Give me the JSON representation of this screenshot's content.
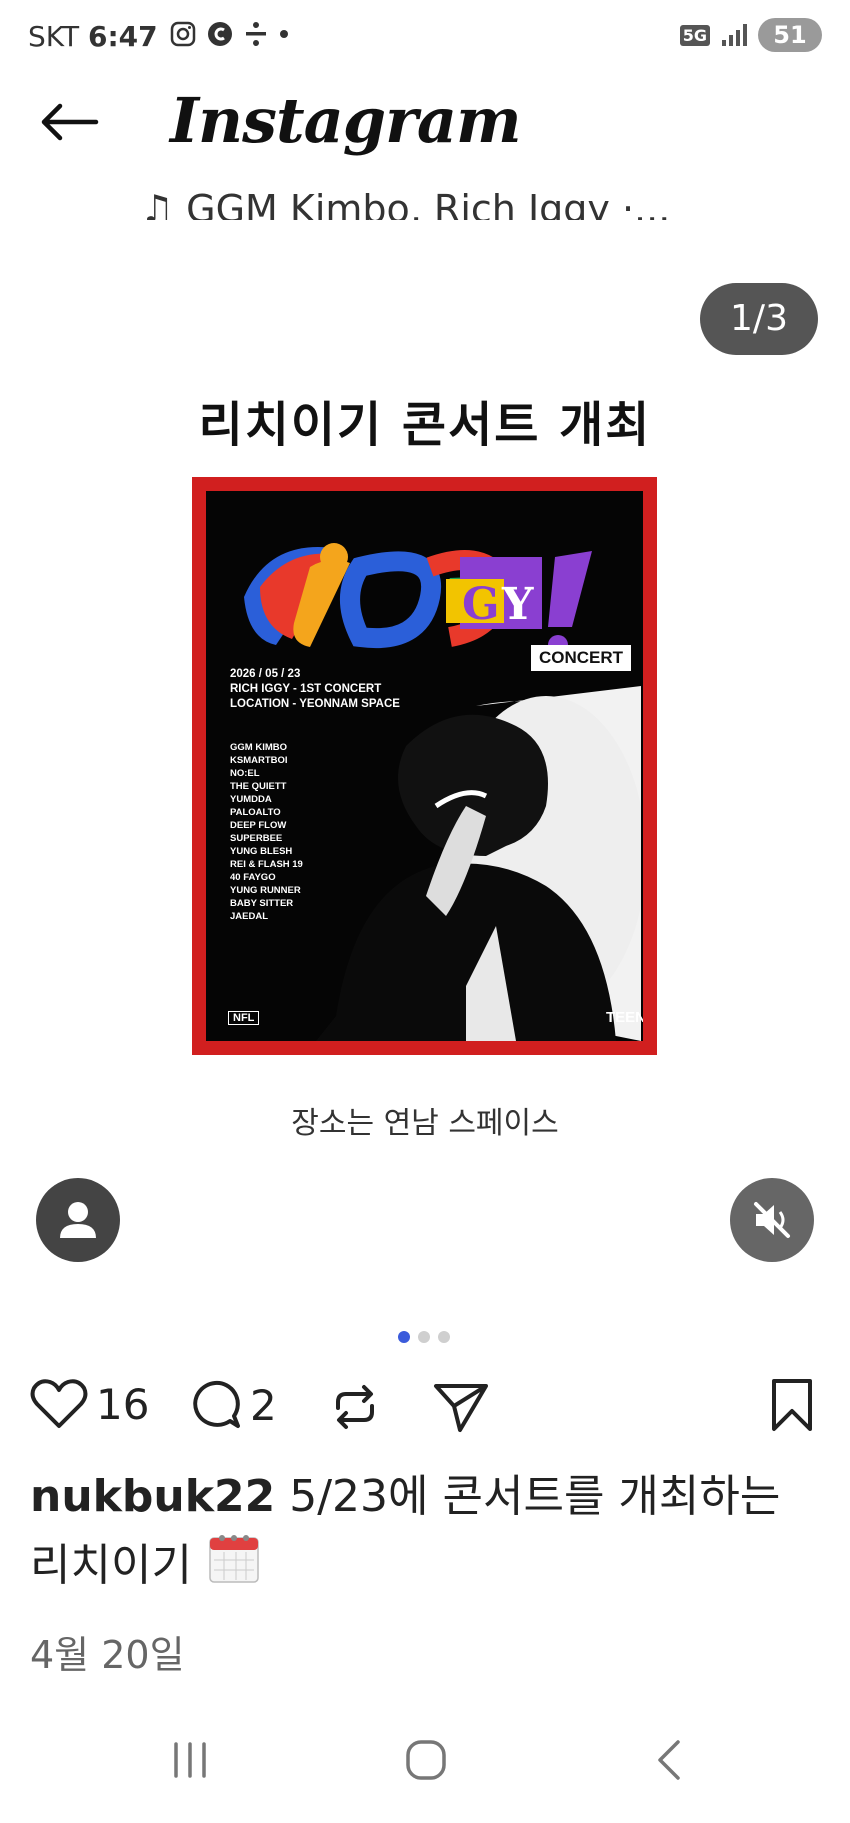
{
  "status_bar": {
    "carrier": "SKT",
    "time": "6:47",
    "network": "5G",
    "battery": "51"
  },
  "header": {
    "brand": "Instagram"
  },
  "music": {
    "ticker": "GGM Kimbo, Rich Iggy ·..."
  },
  "post": {
    "counter": "1/3",
    "title": "리치이기 콘서트 개최",
    "slide_caption": "장소는 연남 스페이스",
    "poster": {
      "logo_text": "iGGY!",
      "concert_badge": "CONCERT",
      "info": [
        "2026 / 05 / 23",
        "RICH IGGY - 1ST CONCERT",
        "LOCATION - YEONNAM SPACE"
      ],
      "lineup": [
        "GGM KIMBO",
        "KSMARTBOI",
        "NO:EL",
        "THE QUIETT",
        "YUMDDA",
        "PALOALTO",
        "DEEP FLOW",
        "SUPERBEE",
        "YUNG BLESH",
        "REI & FLASH 19",
        "40 FAYGO",
        "YUNG RUNNER",
        "BABY SITTER",
        "JAEDAL"
      ],
      "footer_left": "NFL",
      "footer_right": "TEEN"
    },
    "carousel": {
      "total": 3,
      "active_index": 0
    }
  },
  "actions": {
    "likes": "16",
    "comments": "2"
  },
  "caption": {
    "username": "nukbuk22",
    "text": "5/23에 콘서트를 개최하는 리치이기",
    "emoji": "calendar-icon",
    "date": "4월 20일"
  },
  "colors": {
    "accent_dot": "#3b5bdb",
    "poster_border": "#d11f1f"
  }
}
